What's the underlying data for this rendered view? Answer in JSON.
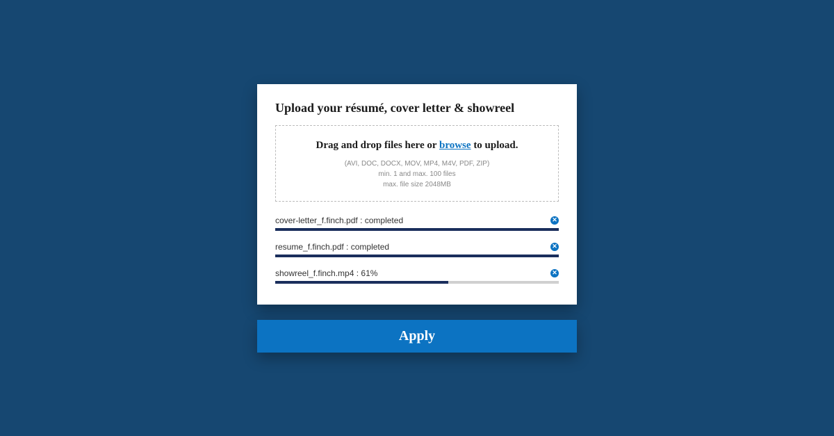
{
  "title": "Upload your résumé, cover letter & showreel",
  "dropzone": {
    "prefix": "Drag and drop files here or ",
    "browse": "browse",
    "suffix": " to upload.",
    "formats": "(AVI, DOC, DOCX, MOV, MP4, M4V, PDF, ZIP)",
    "limits": "min. 1 and max. 100 files",
    "maxsize": "max. file size 2048MB"
  },
  "files": [
    {
      "name": "cover-letter_f.finch.pdf",
      "status": "completed",
      "progress": 100
    },
    {
      "name": "resume_f.finch.pdf",
      "status": "completed",
      "progress": 100
    },
    {
      "name": "showreel_f.finch.mp4",
      "status": "61%",
      "progress": 61
    }
  ],
  "applyLabel": "Apply",
  "colors": {
    "bg": "#164771",
    "accent": "#0c73c2",
    "progress": "#1a2e5c"
  }
}
